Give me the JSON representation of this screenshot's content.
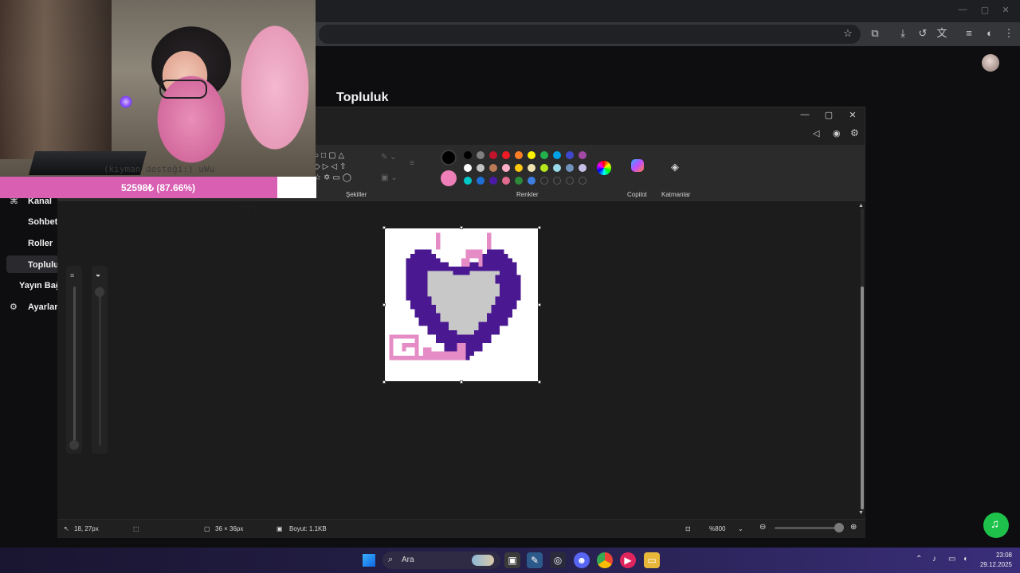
{
  "page": {
    "title": "Topluluk"
  },
  "sidebar": {
    "items": [
      {
        "label": "Kanal"
      },
      {
        "label": "Sohbet"
      },
      {
        "label": "Roller"
      },
      {
        "label": "Toplulu"
      },
      {
        "label": "Yayın Bağ"
      },
      {
        "label": "Ayarlar"
      }
    ]
  },
  "stream_overlay": {
    "donation_text": "(kıyman desteği:) uWu",
    "progress_label": "52598₺ (87.66%)",
    "progress_fraction": 0.8766,
    "goal_text": "TRY60000",
    "accent_color": "#d85fb2"
  },
  "paint": {
    "toolbar": {
      "shapes_label": "Şekiller",
      "colors_label": "Renkler",
      "copilot_label": "Copilot",
      "layers_label": "Katmanlar"
    },
    "palette": {
      "primary": "#000000",
      "secondary": "#ee7fb8",
      "row1": [
        "#000000",
        "#7f7f7f",
        "#c0152a",
        "#ed1c24",
        "#ff7f27",
        "#fff200",
        "#22b14c",
        "#00a2e8",
        "#3f48cc",
        "#a349a4"
      ],
      "row2": [
        "#ffffff",
        "#c3c3c3",
        "#b97a57",
        "#ffaec9",
        "#ffc90e",
        "#efe4b0",
        "#b5e61d",
        "#99d9ea",
        "#7092be",
        "#c8bfe7"
      ],
      "row3": [
        "#00c8c8",
        "#1e6fd8",
        "#4b1aa8",
        "#e06b8e",
        "#2c8a3a",
        "#3d7ee0",
        "",
        "",
        "",
        ""
      ]
    },
    "status": {
      "cursor_position": "18, 27px",
      "canvas_size": "36 × 36px",
      "file_size": "Boyut: 1.1KB",
      "zoom": "%800"
    },
    "art_colors": {
      "outline": "#4a1890",
      "fill": "#c8c8c8",
      "accent": "#e58cc6"
    }
  },
  "taskbar": {
    "search_placeholder": "Ara",
    "time": "23:08",
    "date": "29.12.2025"
  }
}
